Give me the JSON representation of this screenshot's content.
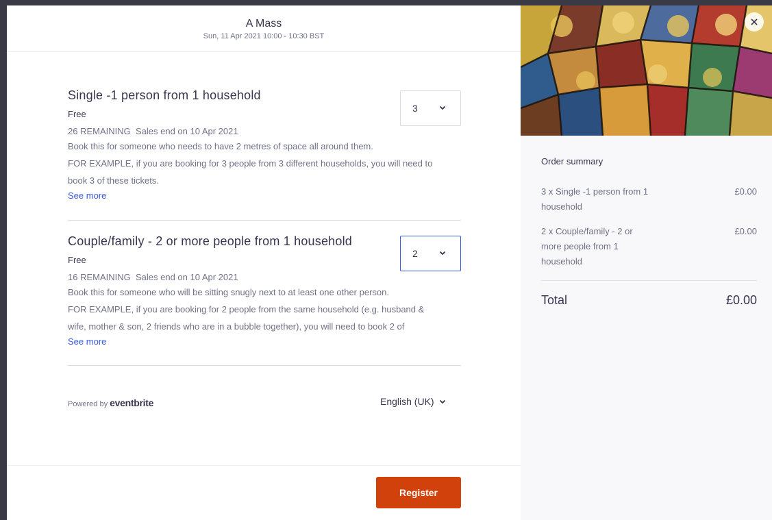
{
  "event": {
    "title": "A Mass",
    "datetime": "Sun, 11 Apr 2021 10:00 - 10:30 BST"
  },
  "tickets": [
    {
      "name": "Single -1 person from 1 household",
      "price": "Free",
      "remaining": "26 REMAINING",
      "sales_end": "Sales end on 10 Apr 2021",
      "desc_lines": [
        "Book this for someone who needs to have 2 metres of space all around them.",
        "FOR EXAMPLE, if you are booking for 3 people from 3 different households, you will need to",
        "book 3 of these tickets."
      ],
      "see_more": "See more",
      "quantity": "3"
    },
    {
      "name": "Couple/family - 2 or more people from 1 household",
      "price": "Free",
      "remaining": "16 REMAINING",
      "sales_end": "Sales end on 10 Apr 2021",
      "desc_lines": [
        "Book this for someone who will be sitting snugly next to at least one other person.",
        "FOR EXAMPLE, if you are booking for 2 people from the same household (e.g. husband &",
        "wife, mother & son, 2 friends who are in a bubble together), you will need to book 2 of"
      ],
      "see_more": "See more",
      "quantity": "2"
    }
  ],
  "footer": {
    "powered_by": "Powered by",
    "brand": "eventbrite",
    "language": "English (UK)",
    "register_label": "Register"
  },
  "summary": {
    "heading": "Order summary",
    "lines": [
      {
        "desc": "3 x Single -1 person from 1 household",
        "amount": "£0.00"
      },
      {
        "desc": "2 x Couple/family - 2 or more people from 1 household",
        "amount": "£0.00"
      }
    ],
    "total_label": "Total",
    "total_amount": "£0.00"
  },
  "colors": {
    "accent": "#3659e3",
    "register": "#d1410c",
    "text": "#39364f",
    "muted": "#6f7287"
  },
  "icons": {
    "close": "close-icon",
    "chevron": "chevron-down-icon",
    "hero": "stained-glass-image"
  }
}
